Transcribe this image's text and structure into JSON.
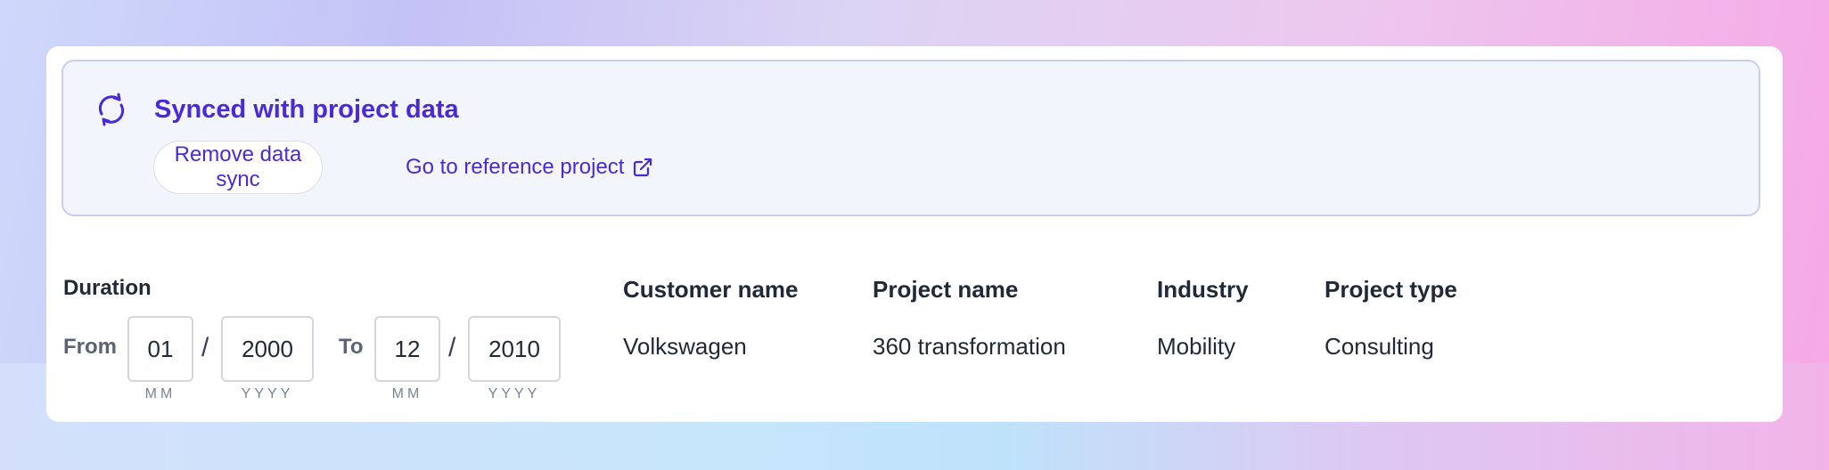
{
  "sync_banner": {
    "title": "Synced with project data",
    "remove_button": "Remove data sync",
    "reference_link": "Go to reference project",
    "accent_color": "#4a2ad6"
  },
  "duration": {
    "label": "Duration",
    "from_label": "From",
    "to_label": "To",
    "separator": "/",
    "from_month": "01",
    "from_year": "2000",
    "to_month": "12",
    "to_year": "2010",
    "month_hint": "MM",
    "year_hint": "YYYY"
  },
  "details": [
    {
      "label": "Customer name",
      "value": "Volkswagen"
    },
    {
      "label": "Project name",
      "value": "360 transformation"
    },
    {
      "label": "Industry",
      "value": "Mobility"
    },
    {
      "label": "Project type",
      "value": "Consulting"
    }
  ],
  "icons": [
    "sync-icon",
    "external-link-icon"
  ]
}
